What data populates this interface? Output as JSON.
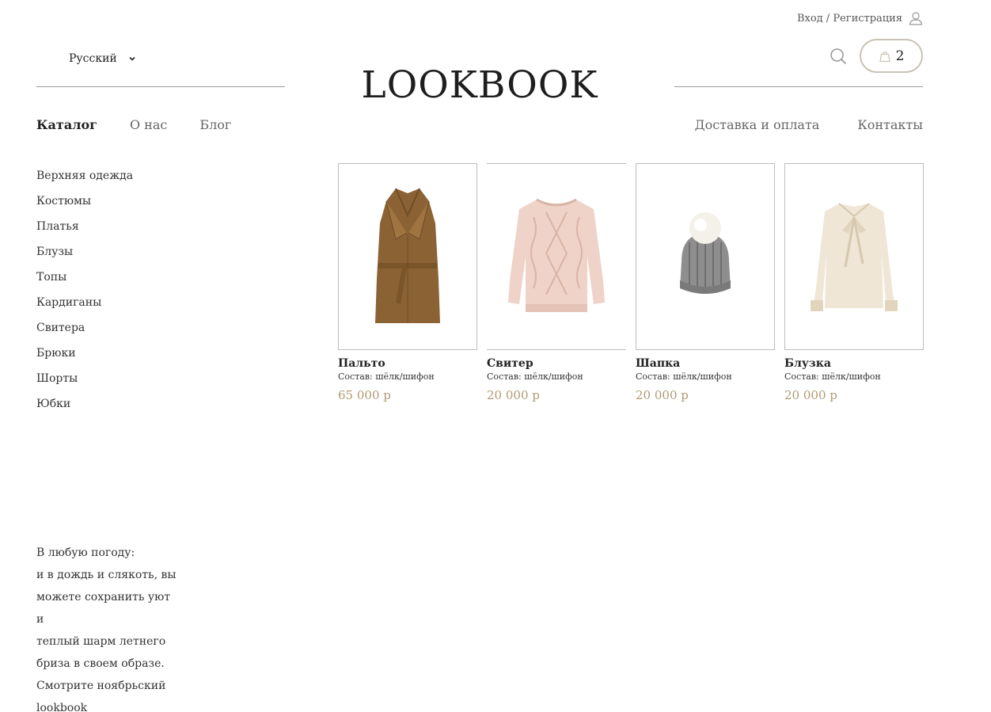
{
  "header": {
    "login_label": "Вход / Регистрация",
    "language": "Русский",
    "logo": "LOOKBOOK",
    "cart_count": "2"
  },
  "nav": {
    "left": [
      {
        "label": "Каталог",
        "active": true
      },
      {
        "label": "О нас"
      },
      {
        "label": "Блог"
      }
    ],
    "right": [
      {
        "label": "Доставка и оплата"
      },
      {
        "label": "Контакты"
      }
    ]
  },
  "categories": [
    "Верхняя одежда",
    "Костюмы",
    "Платья",
    "Блузы",
    "Топы",
    "Кардиганы",
    "Свитера",
    "Брюки",
    "Шорты",
    "Юбки"
  ],
  "products": [
    {
      "name": "Пальто",
      "desc": "Состав: шёлк/шифон",
      "price": "65 000 р",
      "image": "coat"
    },
    {
      "name": "Свитер",
      "desc": "Состав: шёлк/шифон",
      "price": "20 000 р",
      "image": "sweater"
    },
    {
      "name": "Шапка",
      "desc": "Состав: шёлк/шифон",
      "price": "20 000 р",
      "image": "hat"
    },
    {
      "name": "Блузка",
      "desc": "Состав: шёлк/шифон",
      "price": "20 000 р",
      "image": "blouse"
    }
  ],
  "promo": [
    "В любую погоду:",
    "и в дождь и слякоть, вы",
    "можете сохранить уют и",
    "теплый шарм летнего",
    "бриза в своем образе.",
    "Смотрите ноябрьский",
    "lookbook"
  ],
  "colors": {
    "price": "#b09a72",
    "border": "#bdbdbd",
    "cart_border": "#c9c2b6"
  },
  "icons": [
    "user-icon",
    "chevron-down-icon",
    "search-icon",
    "bag-icon"
  ]
}
